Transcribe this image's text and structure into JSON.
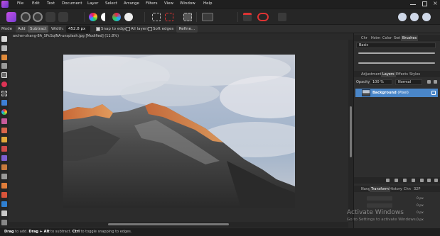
{
  "menu": [
    "File",
    "Edit",
    "Text",
    "Document",
    "Layer",
    "Select",
    "Arrange",
    "Filters",
    "View",
    "Window",
    "Help"
  ],
  "context_bar": {
    "mode_label": "Mode",
    "add_label": "Add",
    "subtract_label": "Subtract",
    "width_label": "Width:",
    "width_value": "452.8 px",
    "snap_to_edges_label": "Snap to edges",
    "all_layers_label": "All layers",
    "soft_edges_label": "Soft edges",
    "refine_label": "Refine..."
  },
  "document": {
    "title": "archer-zhang-8A_SPcSqlNA-unsplash.jpg [Modified] (11.8%)"
  },
  "panels": {
    "top_tabs": [
      "Chr",
      "Hstm",
      "Color",
      "Swt",
      "Brushes"
    ],
    "brush_category": "Basic",
    "middle_tabs": [
      "Adjustment",
      "Layers",
      "Effects",
      "Styles"
    ],
    "opacity_label": "Opacity:",
    "opacity_value": "100 %",
    "blend_mode": "Normal",
    "layer_name": "Background",
    "layer_kind": "(Pixel)",
    "bottom_tabs": [
      "Navg",
      "Transform",
      "History",
      "Chn",
      "32P"
    ],
    "transform_values": [
      "0 px",
      "0 px",
      "0 px",
      "0 px"
    ]
  },
  "status": {
    "drag_key": "Drag",
    "drag_text": " to add. ",
    "alt_key": "Drag + Alt",
    "alt_text": " to subtract. ",
    "ctrl_key": "Ctrl",
    "ctrl_text": " to toggle snapping to edges."
  },
  "watermark": {
    "title": "Activate Windows",
    "subtitle": "Go to Settings to activate Windows."
  }
}
